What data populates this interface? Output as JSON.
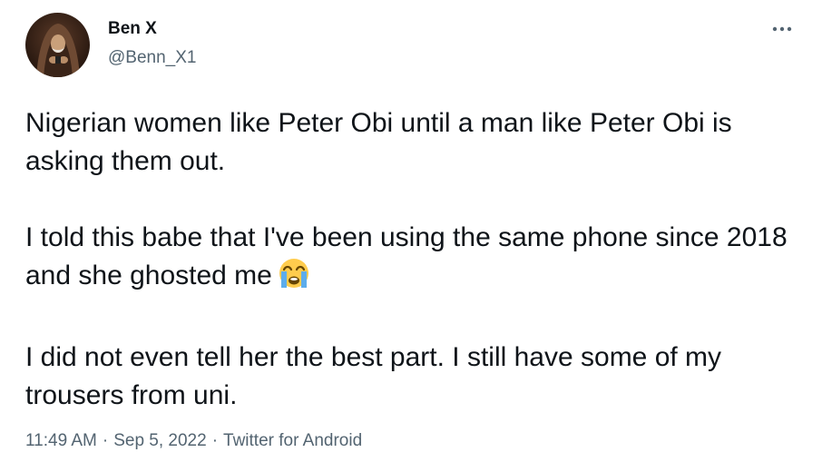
{
  "author": {
    "display_name": "Ben X",
    "handle": "@Benn_X1"
  },
  "menu": {
    "more_label": "···"
  },
  "tweet": {
    "paragraph_1": "Nigerian women like Peter Obi until a man like Peter Obi is asking them out.",
    "paragraph_2": "I told this babe that I've been using the same phone since 2018 and she ghosted me",
    "paragraph_2_emoji": "loudly-crying-face-emoji",
    "paragraph_3": "I did not even tell her the best part. I still have some of my trousers from uni."
  },
  "meta": {
    "time": "11:49 AM",
    "separator": "·",
    "date": "Sep 5, 2022",
    "source": "Twitter for Android"
  },
  "colors": {
    "text_primary": "#0f1419",
    "text_secondary": "#536471",
    "background": "#ffffff"
  }
}
